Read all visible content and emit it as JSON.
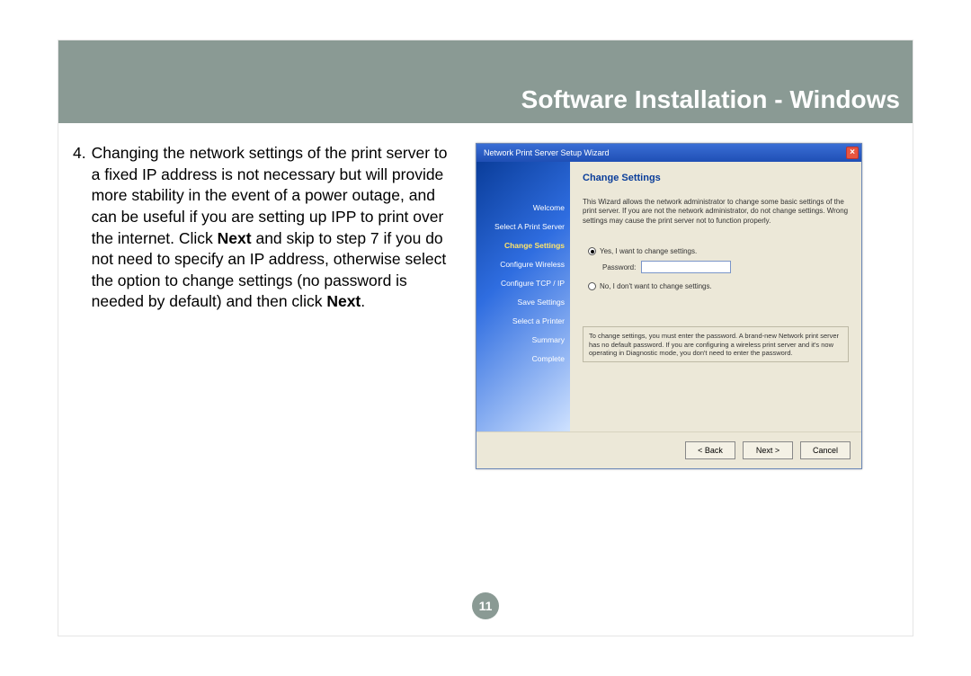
{
  "header": {
    "title": "Software Installation - Windows"
  },
  "step": {
    "number": "4.",
    "text_before_bold1": "Changing the network settings of the print server to a fixed IP address is not necessary but will provide more stability in the event of a power outage, and can be useful if you are setting up IPP to print over the internet.  Click ",
    "bold1": "Next",
    "text_mid": " and skip to step 7 if you do not need to specify an IP address, otherwise select the option to change settings (no password is needed by default) and then click ",
    "bold2": "Next",
    "text_after": "."
  },
  "wizard": {
    "titlebar": "Network Print Server Setup Wizard",
    "close_glyph": "×",
    "side_items": [
      "Welcome",
      "Select A Print Server",
      "Change Settings",
      "Configure Wireless",
      "Configure TCP / IP",
      "Save Settings",
      "Select a Printer",
      "Summary",
      "Complete"
    ],
    "active_index": 2,
    "heading": "Change Settings",
    "intro": "This Wizard allows the network administrator to change some basic settings of the print server. If you are not the network administrator, do not change settings. Wrong settings may cause the print server not to function properly.",
    "radio_yes": "Yes, I want to change settings.",
    "password_label": "Password:",
    "radio_no": "No, I don't want to change settings.",
    "note": "To change settings, you must enter the password. A brand-new Network print server has no default password. If you are configuring a wireless print server and it's now operating in Diagnostic mode, you don't need to enter the password.",
    "buttons": {
      "back": "< Back",
      "next": "Next >",
      "cancel": "Cancel"
    }
  },
  "page_number": "11"
}
